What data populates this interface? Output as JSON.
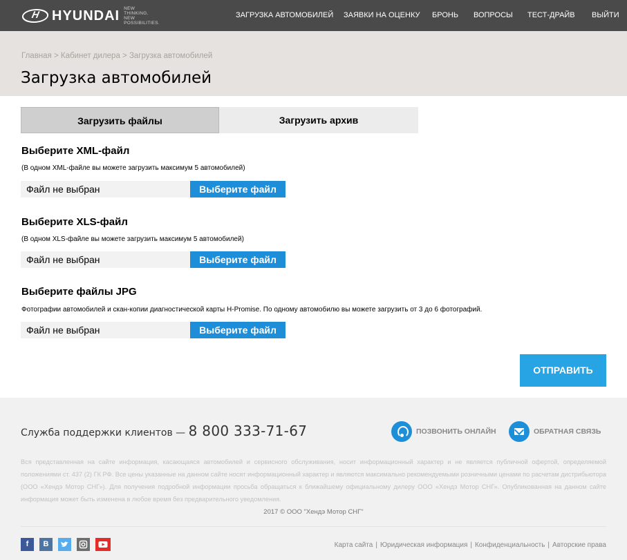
{
  "header": {
    "logo_text": "HYUNDAI",
    "logo_tagline": "NEW THINKING. NEW POSSIBILITIES.",
    "nav": [
      "ЗАГРУЗКА АВТОМОБИЛЕЙ",
      "ЗАЯВКИ НА ОЦЕНКУ",
      "БРОНЬ",
      "ВОПРОСЫ",
      "ТЕСТ-ДРАЙВ",
      "ВЫЙТИ"
    ]
  },
  "page": {
    "breadcrumb": "Главная > Кабинет дилера > Загрузка автомобилей",
    "title": "Загрузка автомобилей"
  },
  "tabs": [
    "Загрузить файлы",
    "Загрузить архив"
  ],
  "sections": [
    {
      "title": "Выберите XML-файл",
      "note": "(В одном XML-файле вы можете загрузить максимум 5 автомобилей)",
      "file_status": "Файл не выбран",
      "button": "Выберите файл"
    },
    {
      "title": "Выберите XLS-файл",
      "note": "(В одном XLS-файле вы можете загрузить максимум 5 автомобилей)",
      "file_status": "Файл не выбран",
      "button": "Выберите файл"
    },
    {
      "title": "Выберите файлы JPG",
      "note": "Фотографии автомобилей и скан-копии диагностической карты H-Promise. По одному автомобилю вы можете загрузить от 3 до 6 фотографий.",
      "file_status": "Файл не выбран",
      "button": "Выберите файл"
    }
  ],
  "submit_label": "ОТПРАВИТЬ",
  "footer": {
    "support_label": "Служба поддержки клиентов — ",
    "phone": "8 800 333-71-67",
    "call_online": "ПОЗВОНИТЬ ОНЛАЙН",
    "feedback": "ОБРАТНАЯ СВЯЗЬ",
    "legal": "Вся представленная на сайте информация, касающаяся автомобилей и сервисного обслуживания, носит информационный характер и не является публичной офертой, определяемой положениями ст. 437 (2) ГК РФ. Все цены указанные на данном сайте носят информационный характер и являются максимально рекомендуемыми розничными ценами по расчетам дистрибьютора (ООО «Хендэ Мотор СНГ»). Для получения подробной информации просьба обращаться к ближайшему официальному дилеру ООО «Хендэ Мотор СНГ». Опубликованная на данном сайте информация может быть изменена в любое время без предварительного уведомления.",
    "copyright": "2017 © ООО \"Хендэ Мотор СНГ\"",
    "links": [
      "Карта сайта",
      "Юридическая информация",
      "Конфиденциальность",
      "Авторские права"
    ],
    "social": [
      {
        "icon": "facebook-icon",
        "glyph": "f",
        "color": "#3b5998"
      },
      {
        "icon": "vk-icon",
        "glyph": "B",
        "color": "#4c75a3"
      },
      {
        "icon": "twitter-icon",
        "glyph": "",
        "color": "#55acee"
      },
      {
        "icon": "instagram-icon",
        "glyph": "",
        "color": "#6e6e6e"
      },
      {
        "icon": "youtube-icon",
        "glyph": "",
        "color": "#e52d27"
      }
    ]
  },
  "colors": {
    "topbar": "#4a4a4a",
    "accent_blue": "#1f8ed8",
    "submit_blue": "#26a4e3",
    "header_band": "#e5e2df"
  }
}
